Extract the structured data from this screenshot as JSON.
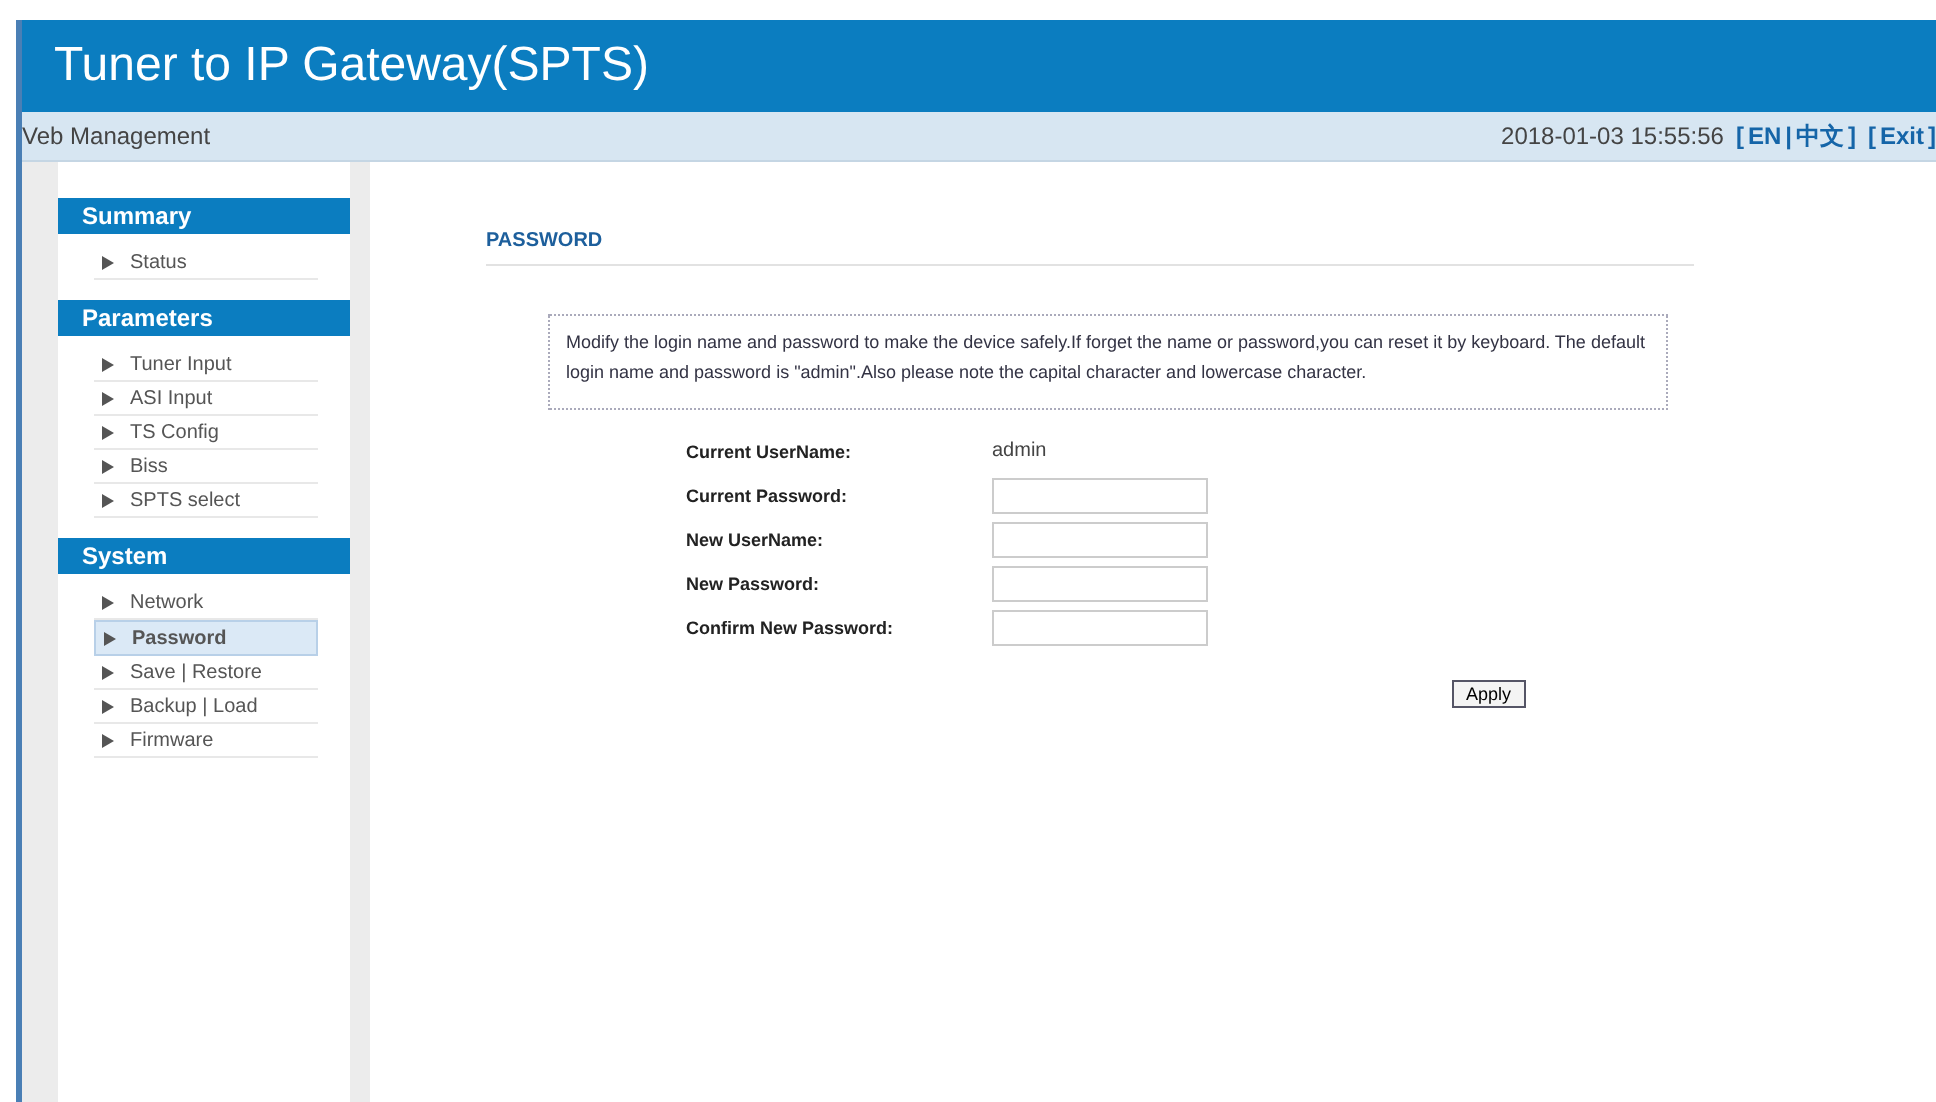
{
  "header": {
    "title": "Tuner to IP Gateway(SPTS)"
  },
  "subheader": {
    "label": "Veb Management",
    "datetime": "2018-01-03 15:55:56",
    "language": {
      "open": "[",
      "options": [
        "EN",
        "中文"
      ],
      "separator": "|",
      "close": "]"
    },
    "exit": {
      "open": "[",
      "label": "Exit",
      "close": "]"
    }
  },
  "sidebar": {
    "sections": [
      {
        "title": "Summary",
        "items": [
          {
            "label": "Status",
            "selected": false
          }
        ]
      },
      {
        "title": "Parameters",
        "items": [
          {
            "label": "Tuner Input",
            "selected": false
          },
          {
            "label": "ASI Input",
            "selected": false
          },
          {
            "label": "TS Config",
            "selected": false
          },
          {
            "label": "Biss",
            "selected": false
          },
          {
            "label": "SPTS select",
            "selected": false
          }
        ]
      },
      {
        "title": "System",
        "items": [
          {
            "label": "Network",
            "selected": false
          },
          {
            "label": "Password",
            "selected": true
          },
          {
            "label": "Save | Restore",
            "selected": false
          },
          {
            "label": "Backup | Load",
            "selected": false
          },
          {
            "label": "Firmware",
            "selected": false
          }
        ]
      }
    ]
  },
  "main": {
    "title": "PASSWORD",
    "notice": "Modify the login name and password to make the device safely.If forget the name or password,you can reset it by keyboard. The default login name and password is \"admin\".Also please note the capital character and lowercase character.",
    "fields": [
      {
        "label": "Current UserName:",
        "kind": "text",
        "value": "admin"
      },
      {
        "label": "Current Password:",
        "kind": "input"
      },
      {
        "label": "New UserName:",
        "kind": "input"
      },
      {
        "label": "New Password:",
        "kind": "input"
      },
      {
        "label": "Confirm New Password:",
        "kind": "input"
      }
    ],
    "apply_button": "Apply"
  }
}
